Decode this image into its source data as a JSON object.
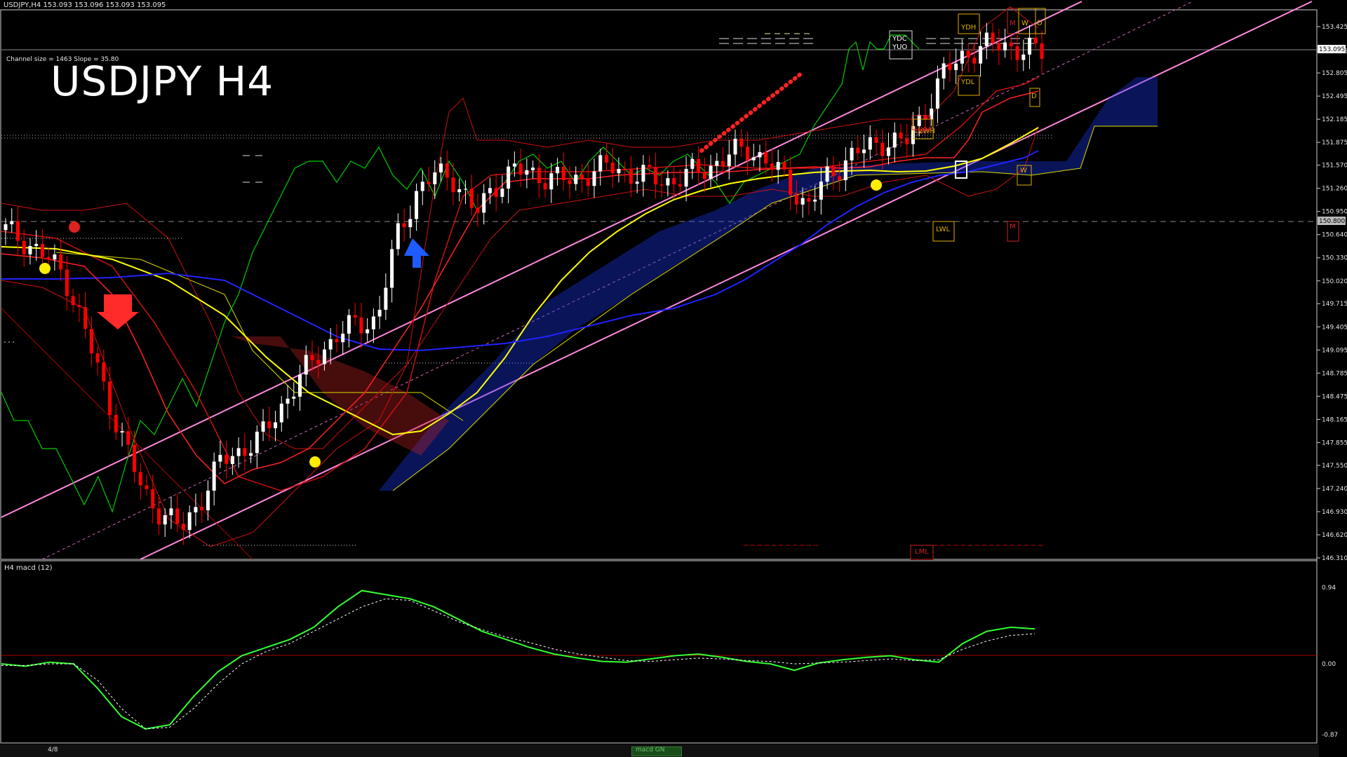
{
  "header": {
    "symbol_line": "USDJPY,H4  153.093 153.096 153.093 153.095",
    "title": "USDJPY H4",
    "channel_info": "Channel size = 1463 Slope = 35.80"
  },
  "macd_panel": {
    "title": "H4  macd (12)",
    "value_label": "0.94"
  },
  "footer": {
    "scroll_label": "macd GN",
    "page": "4/8"
  },
  "colors": {
    "background": "#000000",
    "bull_candle": "#ffffff",
    "bear_candle": "#ff0000",
    "channel": "#ff88dd",
    "sma_yellow": "#ffff00",
    "sma_blue": "#2222ff",
    "chikou": "#00cc00",
    "cloud": "#1e3cff",
    "macd_main": "#33ff33",
    "macd_signal": "#ffffff"
  },
  "markers": {
    "levels": [
      "YDH",
      "YDL",
      "YDC",
      "YUO",
      "LVWH",
      "LWH",
      "LWL",
      "LML",
      "M",
      "W",
      "D"
    ],
    "arrows": [
      {
        "type": "arrow-down",
        "color": "#ff2a2a"
      },
      {
        "type": "arrow-up",
        "color": "#1e5cff"
      }
    ]
  },
  "chart_data": [
    {
      "type": "candlestick",
      "title": "USDJPY H4",
      "y_ticks": [
        "153.425",
        "153.095",
        "152.805",
        "152.495",
        "152.185",
        "151.875",
        "151.570",
        "151.260",
        "150.950",
        "150.640",
        "150.330",
        "150.020",
        "149.715",
        "149.405",
        "149.095",
        "148.785",
        "148.475",
        "148.165",
        "147.855",
        "147.550",
        "147.240",
        "146.930",
        "146.620",
        "146.310"
      ],
      "current_price": "153.095",
      "marked_price": "150.800",
      "ylim": [
        146.31,
        153.425
      ],
      "close_path": [
        150.7,
        150.55,
        150.35,
        150.1,
        149.4,
        148.6,
        147.9,
        147.2,
        146.9,
        146.7,
        147.1,
        147.6,
        147.75,
        147.9,
        148.3,
        148.7,
        149.05,
        149.3,
        149.45,
        149.5,
        150.6,
        151.2,
        151.45,
        151.4,
        150.9,
        151.3,
        151.5,
        151.45,
        151.4,
        151.35,
        151.5,
        151.55,
        151.45,
        151.4,
        151.35,
        151.45,
        151.55,
        151.7,
        151.8,
        151.6,
        151.35,
        151.0,
        151.4,
        151.65,
        151.8,
        151.9,
        151.85,
        152.3,
        152.8,
        153.05,
        153.15,
        153.2,
        153.1,
        153.09
      ]
    },
    {
      "type": "line",
      "title": "H4  macd (12)",
      "y_ticks": [
        "0.94",
        "0.00",
        "-0.87"
      ],
      "ylim": [
        -0.87,
        0.94
      ],
      "series": [
        {
          "values": [
            0.0,
            -0.03,
            0.02,
            0.0,
            -0.3,
            -0.65,
            -0.8,
            -0.75,
            -0.4,
            -0.1,
            0.1,
            0.2,
            0.3,
            0.45,
            0.7,
            0.9,
            0.85,
            0.8,
            0.7,
            0.55,
            0.4,
            0.3,
            0.2,
            0.12,
            0.07,
            0.03,
            0.02,
            0.06,
            0.1,
            0.12,
            0.08,
            0.03,
            0.0,
            -0.08,
            0.01,
            0.05,
            0.08,
            0.1,
            0.05,
            0.02,
            0.25,
            0.4,
            0.45,
            0.43
          ]
        },
        {
          "values": [
            -0.02,
            -0.02,
            0.0,
            0.0,
            -0.2,
            -0.55,
            -0.8,
            -0.78,
            -0.55,
            -0.25,
            0.0,
            0.15,
            0.25,
            0.4,
            0.55,
            0.7,
            0.8,
            0.78,
            0.65,
            0.52,
            0.42,
            0.33,
            0.26,
            0.18,
            0.12,
            0.08,
            0.04,
            0.03,
            0.05,
            0.07,
            0.06,
            0.04,
            0.03,
            0.0,
            0.01,
            0.02,
            0.04,
            0.06,
            0.04,
            0.05,
            0.18,
            0.28,
            0.35,
            0.37
          ]
        }
      ]
    }
  ]
}
